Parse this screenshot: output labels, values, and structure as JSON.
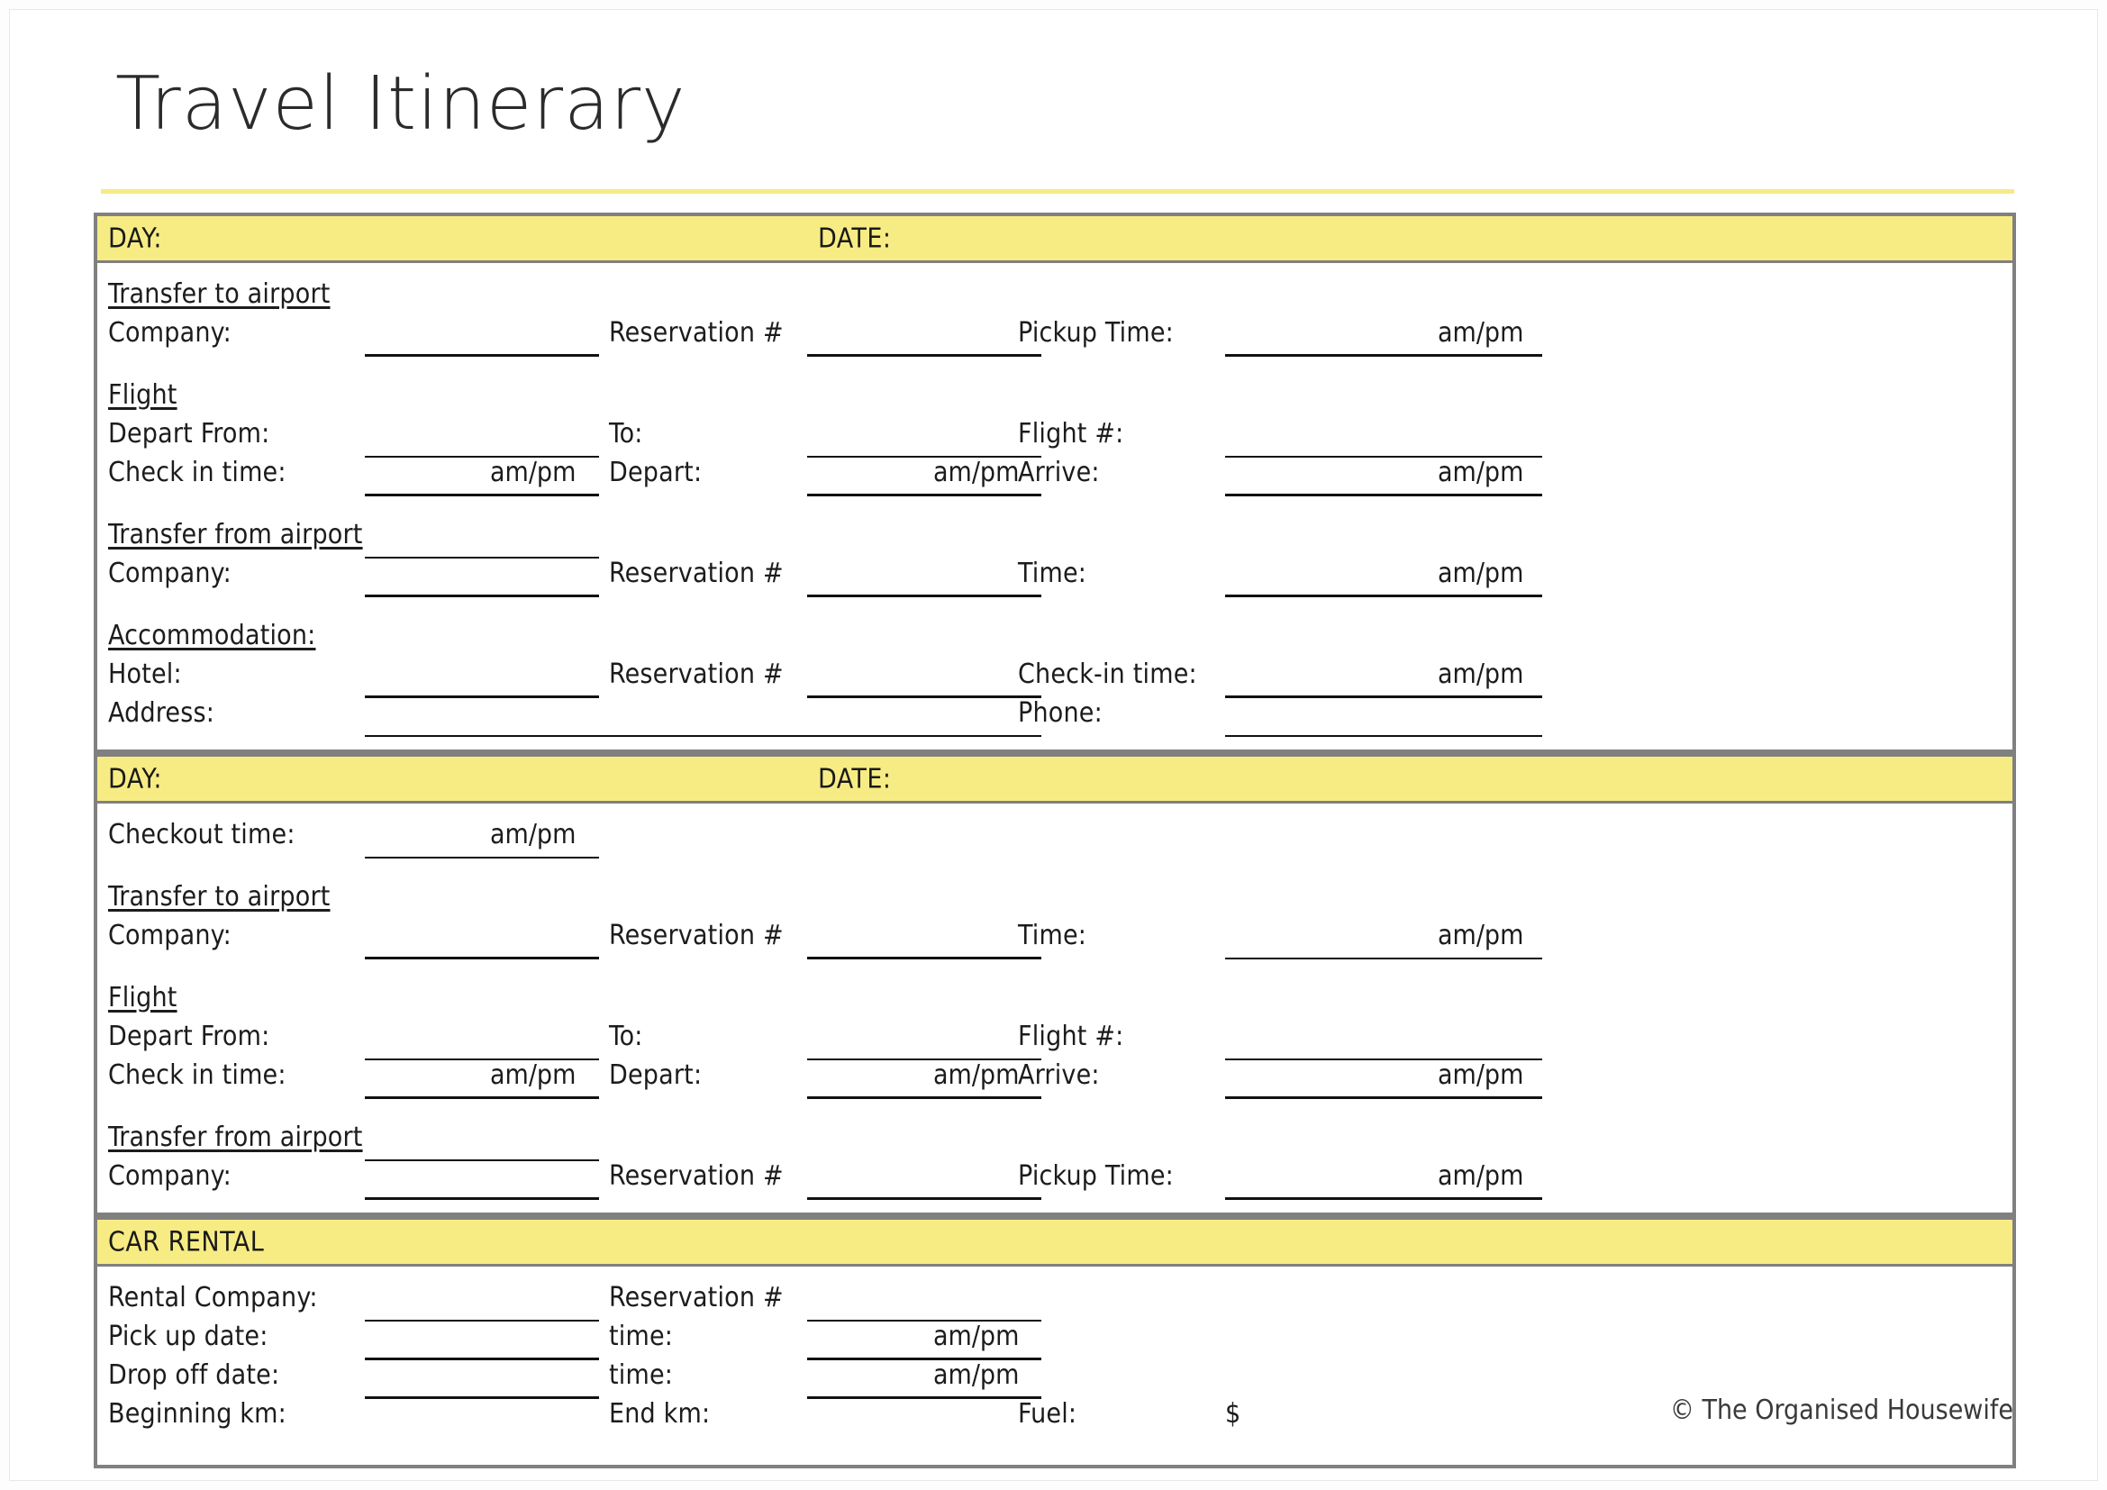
{
  "document": {
    "title": "Travel Itinerary",
    "footer": "© The Organised Housewife",
    "accent_yellow": "#F7EC83",
    "border_gray": "#808080",
    "rule_color": "#111111"
  },
  "labels": {
    "day": "DAY:",
    "date": "DATE:",
    "car_rental": "CAR RENTAL",
    "transfer_to_airport": "Transfer to airport",
    "transfer_from_airport": "Transfer from airport",
    "flight": "Flight",
    "accommodation": "Accommodation:",
    "company": "Company:",
    "reservation": "Reservation #",
    "pickup_time": "Pickup Time:",
    "time": "Time:",
    "time_lower": "time:",
    "depart_from": "Depart From:",
    "to": "To:",
    "flight_no": "Flight #:",
    "check_in_time": "Check in time:",
    "depart": "Depart:",
    "arrive": "Arrive:",
    "hotel": "Hotel:",
    "check_in_time_hyphen": "Check-in time:",
    "address": "Address:",
    "phone": "Phone:",
    "checkout_time": "Checkout time:",
    "rental_company": "Rental Company:",
    "pick_up_date": "Pick up date:",
    "drop_off_date": "Drop off date:",
    "beginning_km": "Beginning km:",
    "end_km": "End km:",
    "fuel": "Fuel:",
    "currency": "$",
    "ampm": "am/pm"
  },
  "sections": [
    {
      "id": "day-one",
      "band": {
        "col1": "DAY:",
        "col2": "DATE:"
      }
    },
    {
      "id": "day-two",
      "band": {
        "col1": "DAY:",
        "col2": "DATE:"
      }
    },
    {
      "id": "car-rental",
      "band": {
        "col1": "CAR RENTAL",
        "col2": ""
      }
    }
  ]
}
